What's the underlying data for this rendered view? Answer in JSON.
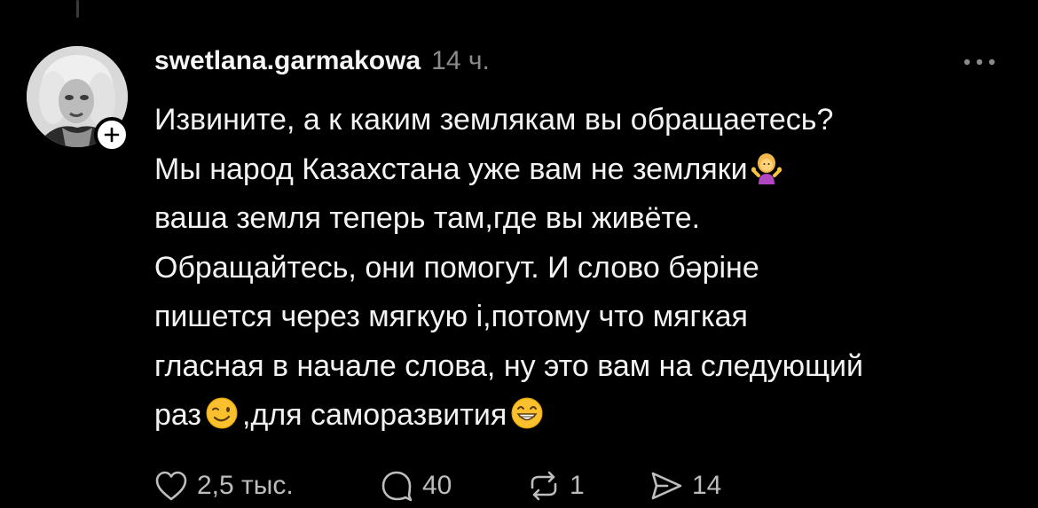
{
  "post": {
    "username": "swetlana.garmakowa",
    "timestamp": "14 ч.",
    "text_lines": [
      "Извините, а к каким землякам вы обращаетесь?",
      "Мы народ Казахстана уже вам не земляки",
      "ваша земля теперь там,где вы живёте.",
      "Обращайтесь, они помогут. И слово бәріне",
      "пишется через мягкую і,потому что мягкая",
      "гласная в начале слова, ну это вам на следующий",
      "раз",
      ",для саморазвития"
    ],
    "emojis": {
      "shrug": "person-shrugging-emoji",
      "wink": "winking-face-emoji",
      "grin": "grinning-face-emoji"
    }
  },
  "actions": {
    "likes": "2,5 тыс.",
    "replies": "40",
    "reposts": "1",
    "shares": "14"
  },
  "colors": {
    "background": "#000000",
    "text": "#f3f3f3",
    "muted": "#8a8a8a",
    "action": "#bdbdbd"
  },
  "icons": {
    "more": "more-dots-icon",
    "follow": "plus-icon",
    "like": "heart-icon",
    "reply": "comment-icon",
    "repost": "repost-icon",
    "share": "share-icon"
  }
}
